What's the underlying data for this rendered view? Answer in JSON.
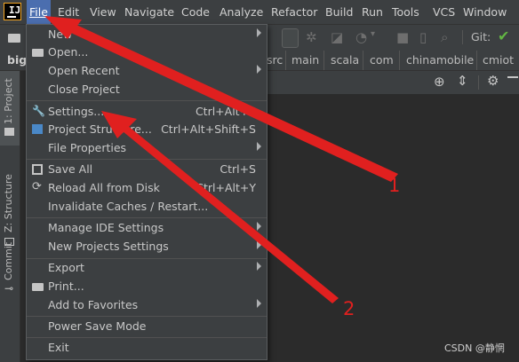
{
  "menubar": {
    "items": [
      {
        "label": "File"
      },
      {
        "label": "Edit"
      },
      {
        "label": "View"
      },
      {
        "label": "Navigate"
      },
      {
        "label": "Code"
      },
      {
        "label": "Analyze"
      },
      {
        "label": "Refactor"
      },
      {
        "label": "Build"
      },
      {
        "label": "Run"
      },
      {
        "label": "Tools"
      },
      {
        "label": "VCS"
      },
      {
        "label": "Window"
      }
    ],
    "active_index": 0
  },
  "toolbar": {
    "git_label": "Git:"
  },
  "breadcrumb": {
    "project_name": "big",
    "items": [
      "src",
      "main",
      "scala",
      "com",
      "chinamobile",
      "cmiot"
    ]
  },
  "left_strip": {
    "tabs": [
      "1: Project",
      "Z: Structure",
      "Commit"
    ]
  },
  "file_menu": {
    "items": [
      {
        "label": "New",
        "icon": null,
        "shortcut": "",
        "submenu": true
      },
      {
        "label": "Open...",
        "icon": "folder-icon",
        "shortcut": "",
        "submenu": false
      },
      {
        "label": "Open Recent",
        "icon": null,
        "shortcut": "",
        "submenu": true
      },
      {
        "label": "Close Project",
        "icon": null,
        "shortcut": "",
        "submenu": false
      },
      {
        "label": "Settings...",
        "icon": "wrench-icon",
        "shortcut": "Ctrl+Alt+S",
        "submenu": false
      },
      {
        "label": "Project Structure...",
        "icon": "project-structure-icon",
        "shortcut": "Ctrl+Alt+Shift+S",
        "submenu": false
      },
      {
        "label": "File Properties",
        "icon": null,
        "shortcut": "",
        "submenu": true
      },
      {
        "label": "Save All",
        "icon": "save-icon",
        "shortcut": "Ctrl+S",
        "submenu": false
      },
      {
        "label": "Reload All from Disk",
        "icon": "reload-icon",
        "shortcut": "Ctrl+Alt+Y",
        "submenu": false
      },
      {
        "label": "Invalidate Caches / Restart...",
        "icon": null,
        "shortcut": "",
        "submenu": false
      },
      {
        "label": "Manage IDE Settings",
        "icon": null,
        "shortcut": "",
        "submenu": true
      },
      {
        "label": "New Projects Settings",
        "icon": null,
        "shortcut": "",
        "submenu": true
      },
      {
        "label": "Export",
        "icon": null,
        "shortcut": "",
        "submenu": true
      },
      {
        "label": "Print...",
        "icon": "print-icon",
        "shortcut": "",
        "submenu": false
      },
      {
        "label": "Add to Favorites",
        "icon": null,
        "shortcut": "",
        "submenu": true
      },
      {
        "label": "Power Save Mode",
        "icon": null,
        "shortcut": "",
        "submenu": false
      },
      {
        "label": "Exit",
        "icon": null,
        "shortcut": "",
        "submenu": false
      }
    ]
  },
  "annotations": {
    "labels": [
      "1",
      "2"
    ],
    "color": "#e0201f"
  },
  "watermark": "CSDN @静惘"
}
